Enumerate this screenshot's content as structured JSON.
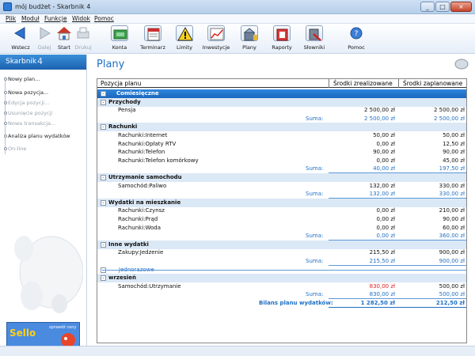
{
  "window": {
    "title": "mój budżet - Skarbnik 4",
    "controls": [
      "_",
      "□",
      "×"
    ]
  },
  "menu": [
    "Plik",
    "Moduł",
    "Funkcje",
    "Widok",
    "Pomoc"
  ],
  "toolbar": [
    {
      "label": "Wstecz",
      "icon": "back-arrow-icon",
      "disabled": false
    },
    {
      "label": "Dalej",
      "icon": "forward-arrow-icon",
      "disabled": true
    },
    {
      "label": "Start",
      "icon": "home-icon",
      "disabled": false
    },
    {
      "label": "Drukuj",
      "icon": "printer-icon",
      "disabled": true
    },
    {
      "label": "Konta",
      "icon": "accounts-icon",
      "disabled": false
    },
    {
      "label": "Terminarz",
      "icon": "calendar-icon",
      "disabled": false
    },
    {
      "label": "Limity",
      "icon": "warning-icon",
      "disabled": false
    },
    {
      "label": "Inwestycje",
      "icon": "investments-icon",
      "disabled": false
    },
    {
      "label": "Plany",
      "icon": "plans-icon",
      "disabled": false
    },
    {
      "label": "Raporty",
      "icon": "reports-icon",
      "disabled": false
    },
    {
      "label": "Słowniki",
      "icon": "dictionaries-icon",
      "disabled": false
    },
    {
      "label": "Pomoc",
      "icon": "help-icon",
      "disabled": false
    }
  ],
  "sidebar": {
    "brand": "Skarbnik",
    "brand_version": "4",
    "items": [
      {
        "label": "Nowy plan...",
        "disabled": false
      },
      {
        "label": "Nowa pozycja...",
        "disabled": false
      },
      {
        "label": "Edycja pozycji...",
        "disabled": true
      },
      {
        "label": "Usunięcie pozycji",
        "disabled": true
      },
      {
        "label": "Nowa transakcja...",
        "disabled": true
      },
      {
        "label": "Analiza planu wydatków",
        "disabled": false
      },
      {
        "label": "On-line",
        "disabled": true
      }
    ],
    "banner": {
      "brand": "Sello",
      "slogan": "sprawdź ceny"
    }
  },
  "main": {
    "title": "Plany",
    "columns": [
      "Pozycja planu",
      "Środki zrealizowane",
      "Środki zaplanowane"
    ],
    "rows": [
      {
        "type": "sel",
        "level": 0,
        "label": "Comiesięczne",
        "a": "",
        "b": "",
        "exp": "-"
      },
      {
        "type": "sec",
        "level": 1,
        "label": "Przychody",
        "a": "",
        "b": "",
        "exp": "-"
      },
      {
        "type": "item",
        "level": 2,
        "label": "Pensja",
        "a": "2 500,00 zł",
        "b": "2 500,00 zł"
      },
      {
        "type": "sum",
        "level": 0,
        "label": "Suma:",
        "a": "2 500,00 zł",
        "b": "2 500,00 zł"
      },
      {
        "type": "sec",
        "level": 1,
        "label": "Rachunki",
        "a": "",
        "b": "",
        "exp": "-"
      },
      {
        "type": "item",
        "level": 2,
        "label": "Rachunki:Internet",
        "a": "50,00 zł",
        "b": "50,00 zł"
      },
      {
        "type": "item",
        "level": 2,
        "label": "Rachunki:Opłaty RTV",
        "a": "0,00 zł",
        "b": "12,50 zł"
      },
      {
        "type": "item",
        "level": 2,
        "label": "Rachunki:Telefon",
        "a": "90,00 zł",
        "b": "90,00 zł"
      },
      {
        "type": "item",
        "level": 2,
        "label": "Rachunki:Telefon komórkowy",
        "a": "0,00 zł",
        "b": "45,00 zł"
      },
      {
        "type": "sum",
        "level": 0,
        "label": "Suma:",
        "a": "40,00 zł",
        "b": "197,50 zł"
      },
      {
        "type": "sec",
        "level": 1,
        "label": "Utrzymanie samochodu",
        "a": "",
        "b": "",
        "exp": "-"
      },
      {
        "type": "item",
        "level": 2,
        "label": "Samochód:Paliwo",
        "a": "132,00 zł",
        "b": "330,00 zł"
      },
      {
        "type": "sum",
        "level": 0,
        "label": "Suma:",
        "a": "132,00 zł",
        "b": "330,00 zł"
      },
      {
        "type": "sec",
        "level": 1,
        "label": "Wydatki na mieszkanie",
        "a": "",
        "b": "",
        "exp": "-"
      },
      {
        "type": "item",
        "level": 2,
        "label": "Rachunki:Czynsz",
        "a": "0,00 zł",
        "b": "210,00 zł"
      },
      {
        "type": "item",
        "level": 2,
        "label": "Rachunki:Prąd",
        "a": "0,00 zł",
        "b": "90,00 zł"
      },
      {
        "type": "item",
        "level": 2,
        "label": "Rachunki:Woda",
        "a": "0,00 zł",
        "b": "60,00 zł"
      },
      {
        "type": "sum",
        "level": 0,
        "label": "Suma:",
        "a": "0,00 zł",
        "b": "360,00 zł"
      },
      {
        "type": "sec",
        "level": 1,
        "label": "Inne wydatki",
        "a": "",
        "b": "",
        "exp": "-"
      },
      {
        "type": "item",
        "level": 2,
        "label": "Zakupy:Jedzenie",
        "a": "215,50 zł",
        "b": "900,00 zł"
      },
      {
        "type": "sum",
        "level": 0,
        "label": "Suma:",
        "a": "215,50 zł",
        "b": "900,00 zł"
      },
      {
        "type": "jedn",
        "level": 0,
        "label": "Jednorazowe",
        "a": "",
        "b": "",
        "exp": "-"
      },
      {
        "type": "sec",
        "level": 1,
        "label": "wrzesień",
        "a": "",
        "b": "",
        "exp": "-"
      },
      {
        "type": "item",
        "level": 2,
        "label": "Samochód:Utrzymanie",
        "a": "830,00 zł",
        "b": "500,00 zł",
        "red": true
      },
      {
        "type": "sum",
        "level": 0,
        "label": "Suma:",
        "a": "830,00 zł",
        "b": "500,00 zł"
      },
      {
        "type": "total",
        "level": 0,
        "label": "Bilans planu wydatków:",
        "a": "1 282,50 zł",
        "b": "212,50 zł"
      }
    ]
  }
}
